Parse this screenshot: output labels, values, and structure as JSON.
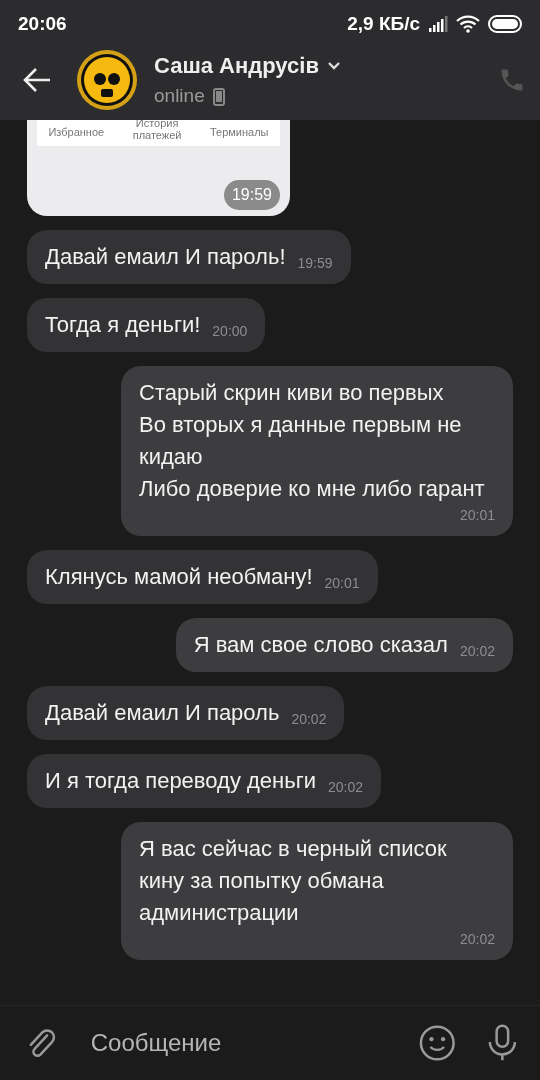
{
  "status_bar": {
    "time": "20:06",
    "network_speed": "2,9 КБ/с"
  },
  "header": {
    "name": "Саша Андрусів",
    "status": "online"
  },
  "messages": [
    {
      "kind": "image",
      "outgoing": false,
      "tabs": [
        "Избранное",
        "История платежей",
        "Терминалы"
      ],
      "time": "19:59"
    },
    {
      "kind": "text",
      "outgoing": false,
      "text": "Давай емаил И пароль!",
      "time": "19:59"
    },
    {
      "kind": "text",
      "outgoing": false,
      "text": "Тогда я деньги!",
      "time": "20:00"
    },
    {
      "kind": "text",
      "outgoing": true,
      "text": "Старый скрин киви во первых\nВо вторых я данные первым не кидаю\nЛибо доверие ко мне либо гарант",
      "time": "20:01"
    },
    {
      "kind": "text",
      "outgoing": false,
      "text": "Клянусь мамой необману!",
      "time": "20:01"
    },
    {
      "kind": "text",
      "outgoing": true,
      "text": "Я вам свое слово сказал",
      "time": "20:02"
    },
    {
      "kind": "text",
      "outgoing": false,
      "text": "Давай емаил И пароль",
      "time": "20:02"
    },
    {
      "kind": "text",
      "outgoing": false,
      "text": "И я тогда переводу деньги",
      "time": "20:02"
    },
    {
      "kind": "text",
      "outgoing": true,
      "text": "Я вас сейчас в черный список кину за попытку обмана администрации",
      "time": "20:02"
    }
  ],
  "composer": {
    "placeholder": "Сообщение"
  }
}
